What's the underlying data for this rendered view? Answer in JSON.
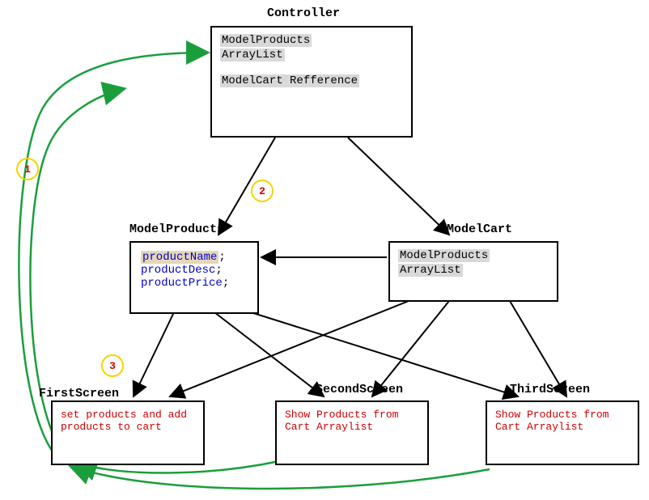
{
  "controller": {
    "title": "Controller",
    "line1": "ModelProducts",
    "line2": "ArrayList",
    "line3": "ModelCart Refference"
  },
  "modelProducts": {
    "title": "ModelProducts",
    "field1": "productName",
    "field2": "productDesc",
    "field3": "productPrice",
    "semi": ";"
  },
  "modelCart": {
    "title": "ModelCart",
    "line1": "ModelProducts",
    "line2": "ArrayList"
  },
  "firstScreen": {
    "title": "FirstScreen",
    "text": "set products and add products to cart"
  },
  "secondScreen": {
    "title": "SecondScreen",
    "text": "Show Products from Cart Arraylist"
  },
  "thirdScreen": {
    "title": "ThirdScreen",
    "text": "Show Products from Cart Arraylist"
  },
  "labels": {
    "n1": "1",
    "n2": "2",
    "n3": "3"
  }
}
